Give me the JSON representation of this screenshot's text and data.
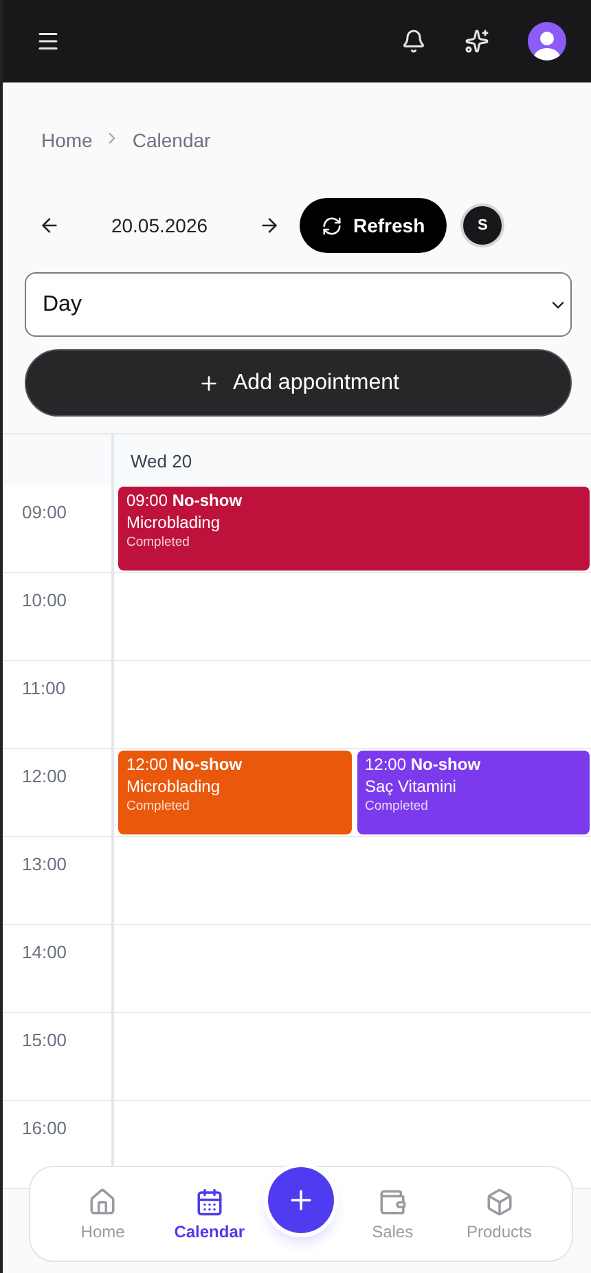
{
  "breadcrumb": [
    "Home",
    "Calendar"
  ],
  "date": "20.05.2026",
  "refresh": "Refresh",
  "staff_avatar": "S",
  "view_select": {
    "value": "Day"
  },
  "add_button": "Add appointment",
  "day_header": "Wed 20",
  "hours": [
    {
      "time": "09:00",
      "events": [
        {
          "time": "09:00",
          "status": "No-show",
          "service": "Microblading",
          "state": "Completed",
          "color": "#be123c"
        }
      ]
    },
    {
      "time": "10:00"
    },
    {
      "time": "11:00"
    },
    {
      "time": "12:00",
      "events": [
        {
          "time": "12:00",
          "status": "No-show",
          "service": "Microblading",
          "state": "Completed",
          "color": "#ea580c"
        },
        {
          "time": "12:00",
          "status": "No-show",
          "service": "Saç Vitamini",
          "state": "Completed",
          "color": "#7c3aed"
        }
      ]
    },
    {
      "time": "13:00"
    },
    {
      "time": "14:00"
    },
    {
      "time": "15:00"
    },
    {
      "time": "16:00"
    }
  ],
  "bottom_nav": [
    {
      "label": "Home",
      "selected": false
    },
    {
      "label": "Calendar",
      "selected": true
    },
    {
      "label": "Sales",
      "selected": false
    },
    {
      "label": "Products",
      "selected": false
    }
  ]
}
